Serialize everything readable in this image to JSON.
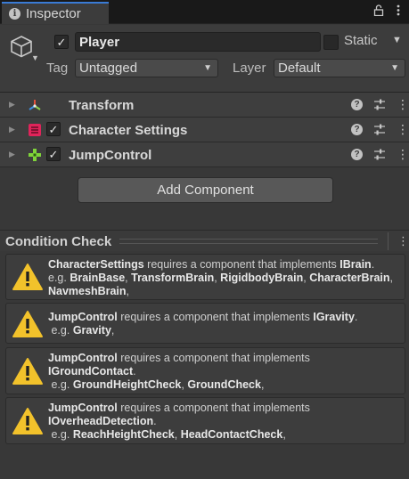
{
  "tab": {
    "label": "Inspector"
  },
  "object": {
    "active": true,
    "name": "Player",
    "static_label": "Static",
    "static_checked": false,
    "tag_label": "Tag",
    "tag_value": "Untagged",
    "layer_label": "Layer",
    "layer_value": "Default"
  },
  "components": [
    {
      "name": "Transform",
      "has_checkbox": false,
      "icon": "transform-icon"
    },
    {
      "name": "Character Settings",
      "has_checkbox": true,
      "checked": true,
      "icon": "character-settings-icon"
    },
    {
      "name": "JumpControl",
      "has_checkbox": true,
      "checked": true,
      "icon": "jump-control-icon"
    }
  ],
  "add_component_label": "Add Component",
  "condition_check": {
    "title": "Condition Check",
    "messages": [
      {
        "component": "CharacterSettings",
        "requires_text": " requires a component that implements ",
        "interface": "IBrain",
        "eg_prefix": "e.g. ",
        "examples": [
          "BrainBase",
          "TransformBrain",
          "RigidbodyBrain",
          "CharacterBrain",
          "NavmeshBrain"
        ]
      },
      {
        "component": "JumpControl",
        "requires_text": " requires a component that implements ",
        "interface": "IGravity",
        "eg_prefix": "e.g. ",
        "examples": [
          "Gravity"
        ]
      },
      {
        "component": "JumpControl",
        "requires_text": " requires a component that implements ",
        "interface": "IGroundContact",
        "eg_prefix": "e.g. ",
        "examples": [
          "GroundHeightCheck",
          "GroundCheck"
        ]
      },
      {
        "component": "JumpControl",
        "requires_text": " requires a component that implements ",
        "interface": "IOverheadDetection",
        "eg_prefix": "e.g. ",
        "examples": [
          "ReachHeightCheck",
          "HeadContactCheck"
        ]
      }
    ]
  },
  "colors": {
    "accent_tab": "#3a7bd5",
    "warning": "#f2c22b",
    "transform_x": "#e0503a",
    "transform_y": "#8fd14f",
    "transform_z": "#3d8fe0",
    "character_settings": "#e0245a",
    "jump_control": "#7fd43a"
  }
}
